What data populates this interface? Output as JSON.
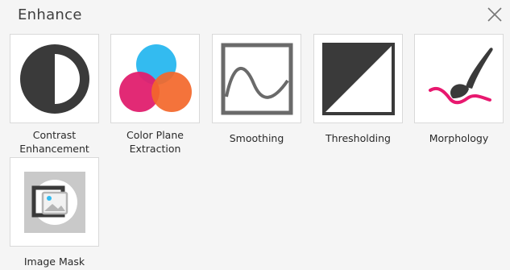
{
  "dialog": {
    "title": "Enhance",
    "close_icon": "close-icon"
  },
  "tools": [
    {
      "label": "Contrast\nEnhancement",
      "icon": "contrast-icon"
    },
    {
      "label": "Color Plane\nExtraction",
      "icon": "color-planes-icon"
    },
    {
      "label": "Smoothing",
      "icon": "smoothing-icon"
    },
    {
      "label": "Thresholding",
      "icon": "thresholding-icon"
    },
    {
      "label": "Morphology",
      "icon": "brush-icon"
    },
    {
      "label": "Image Mask",
      "icon": "image-mask-icon"
    }
  ],
  "colors": {
    "icon_dark": "#3a3a3a",
    "cyan": "#33bbf0",
    "magenta": "#e01f6e",
    "orange": "#f3672a",
    "pink_stroke": "#e8186f"
  }
}
